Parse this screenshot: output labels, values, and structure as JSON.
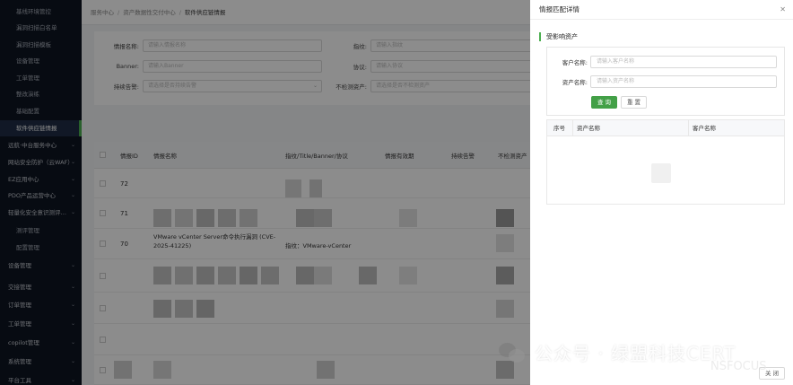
{
  "sidebar": {
    "items": [
      {
        "label": "基线环境管控",
        "kind": "sub"
      },
      {
        "label": "漏洞扫描白名单",
        "kind": "sub"
      },
      {
        "label": "漏洞扫描模板",
        "kind": "sub"
      },
      {
        "label": "设备管理",
        "kind": "sub"
      },
      {
        "label": "工单管理",
        "kind": "sub"
      },
      {
        "label": "整改演练",
        "kind": "sub"
      },
      {
        "label": "基础配置",
        "kind": "sub"
      },
      {
        "label": "软件供应链情报",
        "kind": "active"
      },
      {
        "label": "远航·中台服务中心",
        "kind": "group"
      },
      {
        "label": "网站安全防护（云WAF）",
        "kind": "group"
      },
      {
        "label": "EZ应用中心",
        "kind": "group"
      },
      {
        "label": "PDO产品运营中心",
        "kind": "group"
      },
      {
        "label": "轻量化安全意识测评…",
        "kind": "group"
      },
      {
        "label": "测评管理",
        "kind": "sub"
      },
      {
        "label": "配置管理",
        "kind": "sub"
      },
      {
        "label": "设备管理",
        "kind": "group"
      },
      {
        "label": "交接管理",
        "kind": "group"
      },
      {
        "label": "订单管理",
        "kind": "group"
      },
      {
        "label": "工单管理",
        "kind": "group"
      },
      {
        "label": "copilot管理",
        "kind": "group"
      },
      {
        "label": "系统管理",
        "kind": "group"
      },
      {
        "label": "平台工具",
        "kind": "group"
      }
    ]
  },
  "breadcrumb": {
    "items": [
      "服务中心",
      "资产数据性交付中心",
      "软件供应链情报"
    ]
  },
  "filters": {
    "name_label": "情报名称:",
    "name_placeholder": "请输入情报名称",
    "banner_label": "Banner:",
    "banner_placeholder": "请输入Banner",
    "alert_label": "持续告警:",
    "alert_placeholder": "请选择是否持续告警",
    "fingerprint_label": "指纹:",
    "fingerprint_placeholder": "请输入指纹",
    "protocol_label": "协议:",
    "protocol_placeholder": "请输入协议",
    "nodetect_label": "不检测资产:",
    "nodetect_placeholder": "请选择是否不检测资产"
  },
  "table": {
    "headers": [
      "情报ID",
      "情报名称",
      "指纹/Title/Banner/协议",
      "情报有效期",
      "持续告警",
      "不检测资产"
    ],
    "rows": [
      {
        "id": "72",
        "name": "",
        "fingerprint": ""
      },
      {
        "id": "71",
        "name": "",
        "fingerprint": ""
      },
      {
        "id": "70",
        "name": "VMware vCenter Server命令执行漏洞 (CVE-2025-41225)",
        "fingerprint": "指纹：VMware-vCenter"
      },
      {
        "id": "",
        "name": "",
        "fingerprint": ""
      },
      {
        "id": "",
        "name": "",
        "fingerprint": ""
      },
      {
        "id": "",
        "name": "",
        "fingerprint": ""
      },
      {
        "id": "",
        "name": "",
        "fingerprint": ""
      }
    ]
  },
  "drawer": {
    "title": "情报匹配详情",
    "close_icon": "close-icon",
    "section_title": "受影响资产",
    "customer_label": "客户名称:",
    "customer_placeholder": "请输入客户名称",
    "asset_label": "资产名称:",
    "asset_placeholder": "请输入资产名称",
    "query_label": "查 询",
    "reset_label": "重 置",
    "result_headers": [
      "序号",
      "资产名称",
      "客户名称"
    ],
    "close_button": "关 闭"
  },
  "watermark": {
    "text": "公众号 · 绿盟科技CERT",
    "sub": "NSFOCUS"
  },
  "colors": {
    "accent": "#43a047",
    "sidebar_bg": "#0d1422",
    "mask": "rgba(0,0,0,0.45)"
  }
}
